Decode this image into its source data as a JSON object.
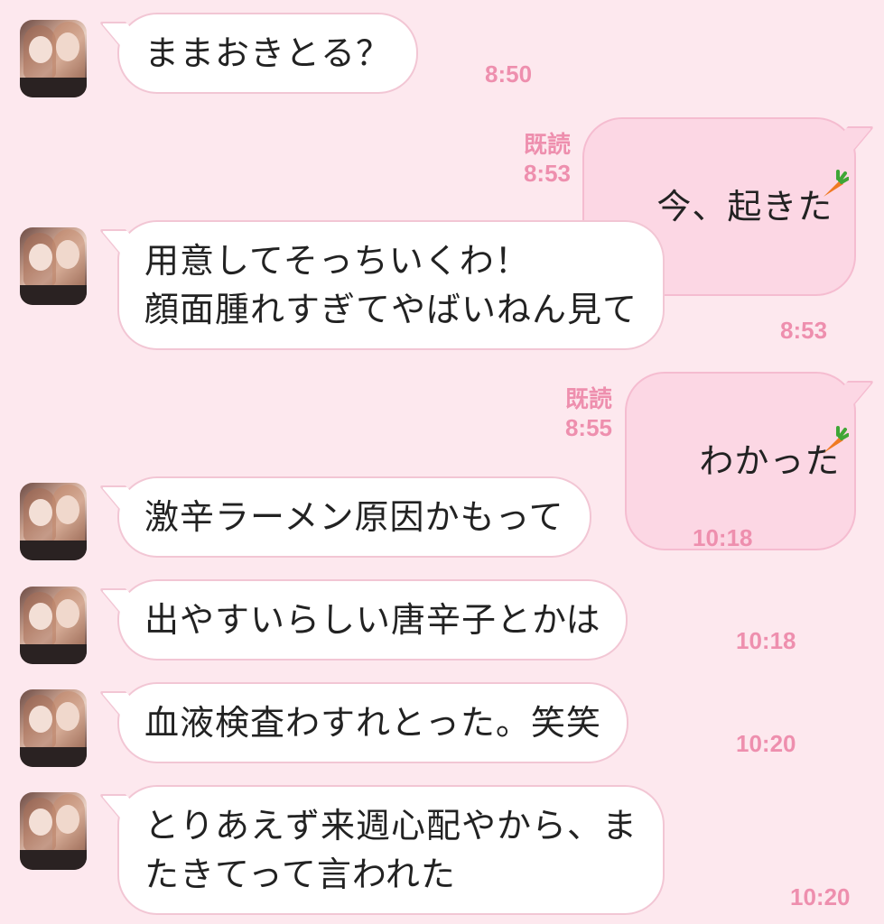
{
  "messages": [
    {
      "direction": "in",
      "text": "ままおきとる？",
      "time": "8:50"
    },
    {
      "direction": "out",
      "text": "今、起きた",
      "read_label": "既読",
      "time": "8:53"
    },
    {
      "direction": "in",
      "text": "用意してそっちいくわ！\n顔面腫れすぎてやばいねん見て",
      "time": "8:53"
    },
    {
      "direction": "out",
      "text": "わかった",
      "read_label": "既読",
      "time": "8:55"
    },
    {
      "direction": "in",
      "text": "激辛ラーメン原因かもって",
      "time": "10:18"
    },
    {
      "direction": "in",
      "text": "出やすいらしい唐辛子とかは",
      "time": "10:18"
    },
    {
      "direction": "in",
      "text": "血液検査わすれとった。笑笑",
      "time": "10:20"
    },
    {
      "direction": "in",
      "text": "とりあえず来週心配やから、ま\nたきてって言われた",
      "time": "10:20"
    }
  ],
  "colors": {
    "background": "#fde8ee",
    "incoming_bubble": "#ffffff",
    "outgoing_bubble": "#fcd7e4",
    "timestamp": "#ee8fae"
  },
  "icons": {
    "sticker_emoji": "carrot-icon"
  }
}
